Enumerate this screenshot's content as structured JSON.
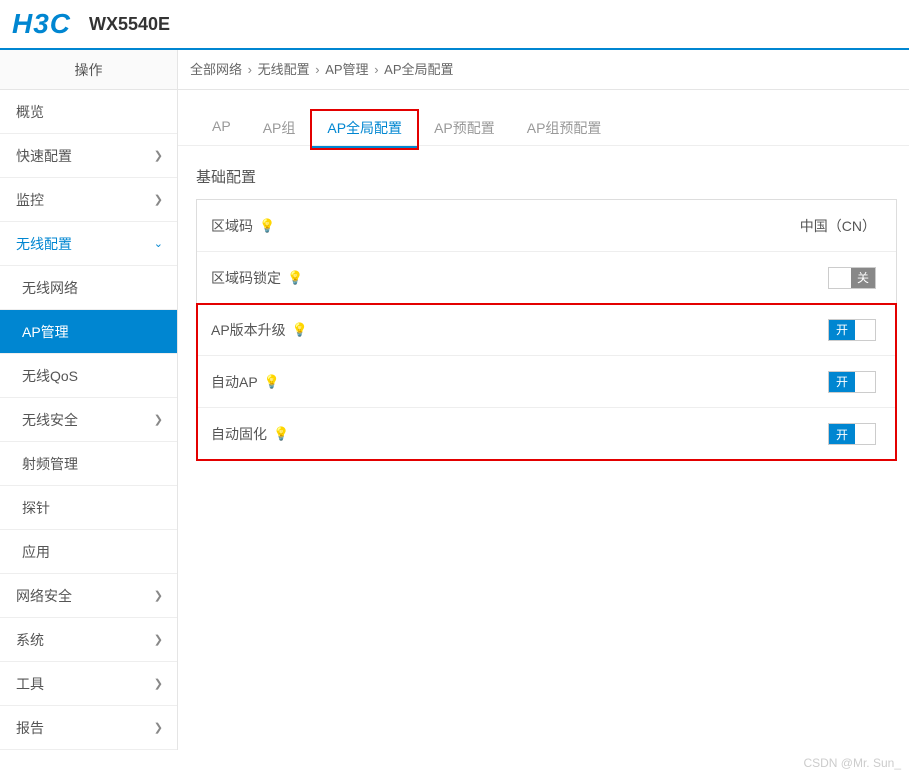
{
  "header": {
    "brand": "H3C",
    "model": "WX5540E"
  },
  "sidebar": {
    "title": "操作",
    "items": [
      {
        "label": "概览",
        "type": "plain"
      },
      {
        "label": "快速配置",
        "type": "expand"
      },
      {
        "label": "监控",
        "type": "expand"
      },
      {
        "label": "无线配置",
        "type": "expand-open",
        "active": true
      },
      {
        "label": "无线网络",
        "type": "sub"
      },
      {
        "label": "AP管理",
        "type": "sub",
        "active": true
      },
      {
        "label": "无线QoS",
        "type": "sub"
      },
      {
        "label": "无线安全",
        "type": "sub-expand"
      },
      {
        "label": "射频管理",
        "type": "sub"
      },
      {
        "label": "探针",
        "type": "sub"
      },
      {
        "label": "应用",
        "type": "sub"
      },
      {
        "label": "网络安全",
        "type": "expand"
      },
      {
        "label": "系统",
        "type": "expand"
      },
      {
        "label": "工具",
        "type": "expand"
      },
      {
        "label": "报告",
        "type": "expand"
      }
    ]
  },
  "breadcrumb": {
    "parts": [
      "全部网络",
      "无线配置",
      "AP管理",
      "AP全局配置"
    ]
  },
  "tabs": [
    {
      "label": "AP"
    },
    {
      "label": "AP组"
    },
    {
      "label": "AP全局配置",
      "active": true,
      "highlighted": true
    },
    {
      "label": "AP预配置"
    },
    {
      "label": "AP组预配置"
    }
  ],
  "section": {
    "title": "基础配置",
    "rows": [
      {
        "label": "区域码",
        "value": "中国（CN）",
        "control": "text"
      },
      {
        "label": "区域码锁定",
        "control": "toggle",
        "state": "off",
        "text": "关"
      },
      {
        "label": "AP版本升级",
        "control": "toggle",
        "state": "on",
        "text": "开",
        "highlighted": true
      },
      {
        "label": "自动AP",
        "control": "toggle",
        "state": "on",
        "text": "开",
        "highlighted": true
      },
      {
        "label": "自动固化",
        "control": "toggle",
        "state": "on",
        "text": "开",
        "highlighted": true
      }
    ]
  },
  "watermark": "CSDN @Mr. Sun_"
}
